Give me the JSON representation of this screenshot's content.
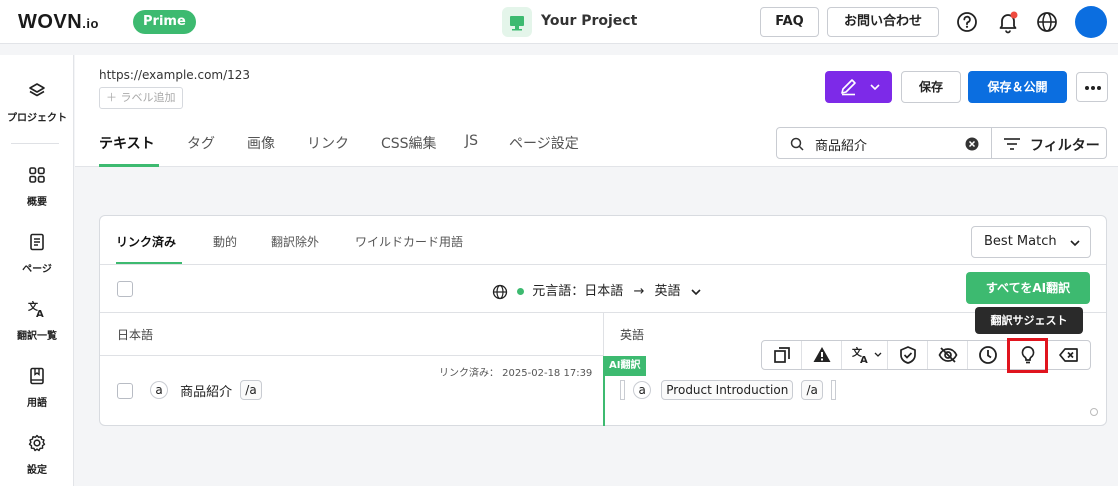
{
  "header": {
    "logo_text": "WOVN",
    "logo_suffix": ".io",
    "plan_badge": "Prime",
    "project_name": "Your Project",
    "faq_label": "FAQ",
    "contact_label": "お問い合わせ"
  },
  "sidebar": {
    "items": [
      {
        "label": "プロジェクト",
        "icon": "layers-icon"
      },
      {
        "label": "概要",
        "icon": "grid-icon"
      },
      {
        "label": "ページ",
        "icon": "document-icon"
      },
      {
        "label": "翻訳一覧",
        "icon": "translate-icon"
      },
      {
        "label": "用語",
        "icon": "book-icon"
      },
      {
        "label": "設定",
        "icon": "gear-icon"
      }
    ]
  },
  "page": {
    "url": "https://example.com/123",
    "add_label": "ラベル追加",
    "save_label": "保存",
    "save_publish_label": "保存＆公開",
    "tabs": [
      "テキスト",
      "タグ",
      "画像",
      "リンク",
      "CSS編集",
      "JS",
      "ページ設定"
    ],
    "search_value": "商品紹介",
    "filter_label": "フィルター"
  },
  "card": {
    "subtabs": [
      "リンク済み",
      "動的",
      "翻訳除外",
      "ワイルドカード用語"
    ],
    "sort_value": "Best Match",
    "source_lang_label": "元言語：日本語",
    "arrow": "→",
    "target_lang": "英語",
    "ai_all_button": "すべてをAI翻訳",
    "col_source": "日本語",
    "col_target": "英語",
    "ai_badge": "AI翻訳",
    "linked_info": "リンク済み： 2025-02-18 17:39",
    "source_tag_a": "a",
    "source_text": "商品紹介",
    "source_tag_close": "/a",
    "target_tag_a": "a",
    "target_text": "Product Introduction",
    "target_tag_close": "/a",
    "tooltip": "翻訳サジェスト"
  },
  "colors": {
    "accent_green": "#3dba70",
    "primary_blue": "#0b6ee0",
    "purple": "#7d2ae8",
    "highlight_red": "#e0141e"
  }
}
